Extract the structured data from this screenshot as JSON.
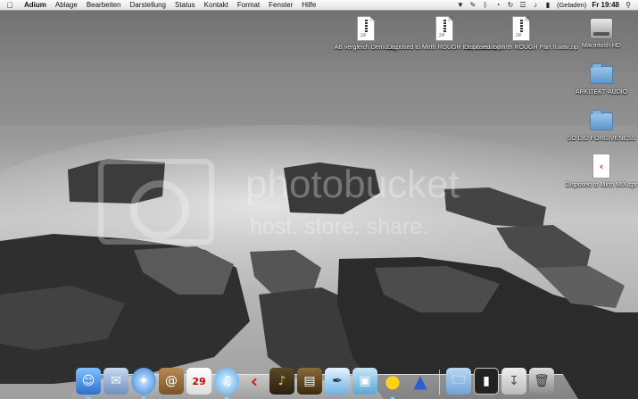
{
  "menubar": {
    "apple": "",
    "items": [
      "Adium",
      "Ablage",
      "Bearbeiten",
      "Darstellung",
      "Status",
      "Kontakt",
      "Format",
      "Fenster",
      "Hilfe"
    ],
    "battery_status": "(Geladen)",
    "clock": "Fr 19:48"
  },
  "desktop_icons": {
    "file1": "AB vergleich Demo.zip",
    "file2": "Disposed to Mirth ROUGH Part II.wav.zip",
    "file3": "Disposed to Mirth ROUGH Part II.wav.zip",
    "hd": "Macintosh HD",
    "folder1": "ARKITEKT-AUDIO",
    "folder2": "SO DID FORGIVENESS",
    "logic": "Disposed to Mirth MIX.cpr"
  },
  "watermark": {
    "main": "photobucket",
    "sub": "host. store. share."
  },
  "colors": {
    "menubar": "#eeeeee",
    "folder": "#7fb0de",
    "dock_indicator": "#8fd3ff"
  }
}
